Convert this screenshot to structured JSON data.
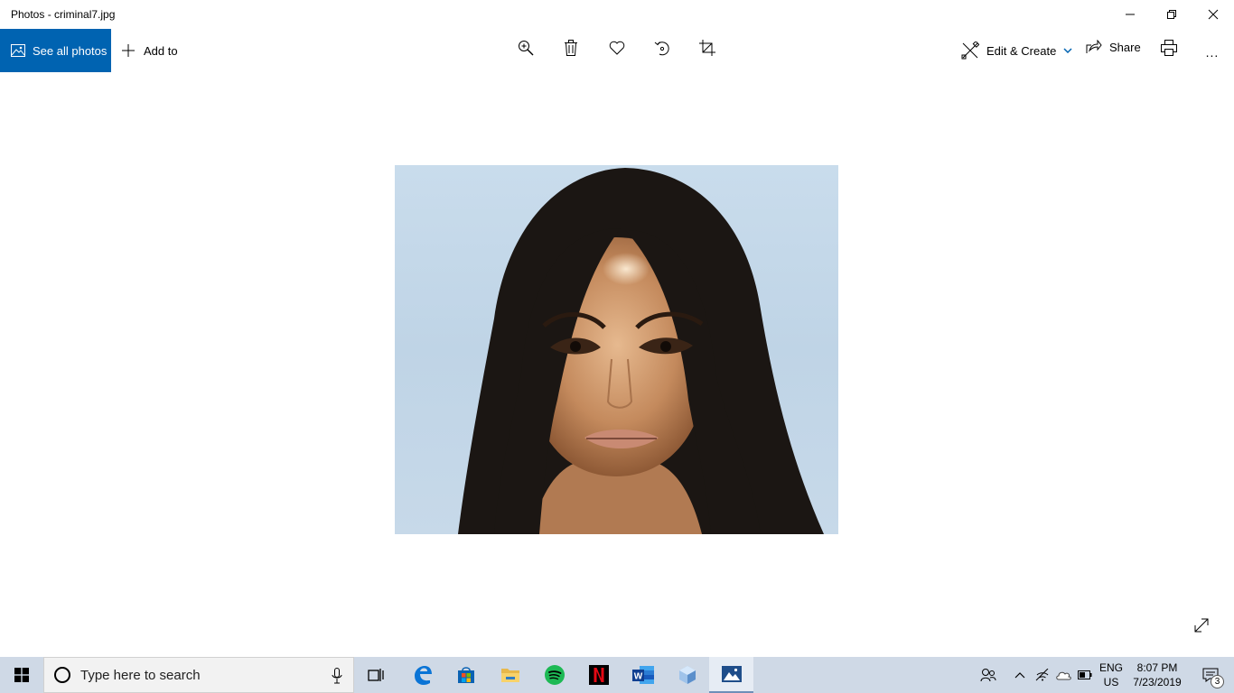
{
  "window": {
    "title": "Photos - criminal7.jpg",
    "controls": [
      "minimize-icon",
      "restore-icon",
      "close-icon"
    ]
  },
  "toolbar": {
    "see_all_label": "See all photos",
    "add_to_label": "Add to",
    "tools": [
      "zoom-icon",
      "delete-icon",
      "favorite-icon",
      "rotate-icon",
      "crop-icon"
    ],
    "edit_create_label": "Edit & Create",
    "share_label": "Share",
    "more_label": "...",
    "accent_color": "#0063b1"
  },
  "viewer": {
    "photo_icon": "portrait-photo",
    "expand_icon": "expand-icon"
  },
  "taskbar": {
    "search_placeholder": "Type here to search",
    "apps": [
      "task-view-icon",
      "edge-icon",
      "store-icon",
      "file-explorer-icon",
      "spotify-icon",
      "netflix-icon",
      "word-icon",
      "box-app-icon",
      "photos-icon"
    ],
    "lang_line1": "ENG",
    "lang_line2": "US",
    "time": "8:07 PM",
    "date": "7/23/2019",
    "notification_count": "3",
    "background": "#cfd9e6"
  }
}
